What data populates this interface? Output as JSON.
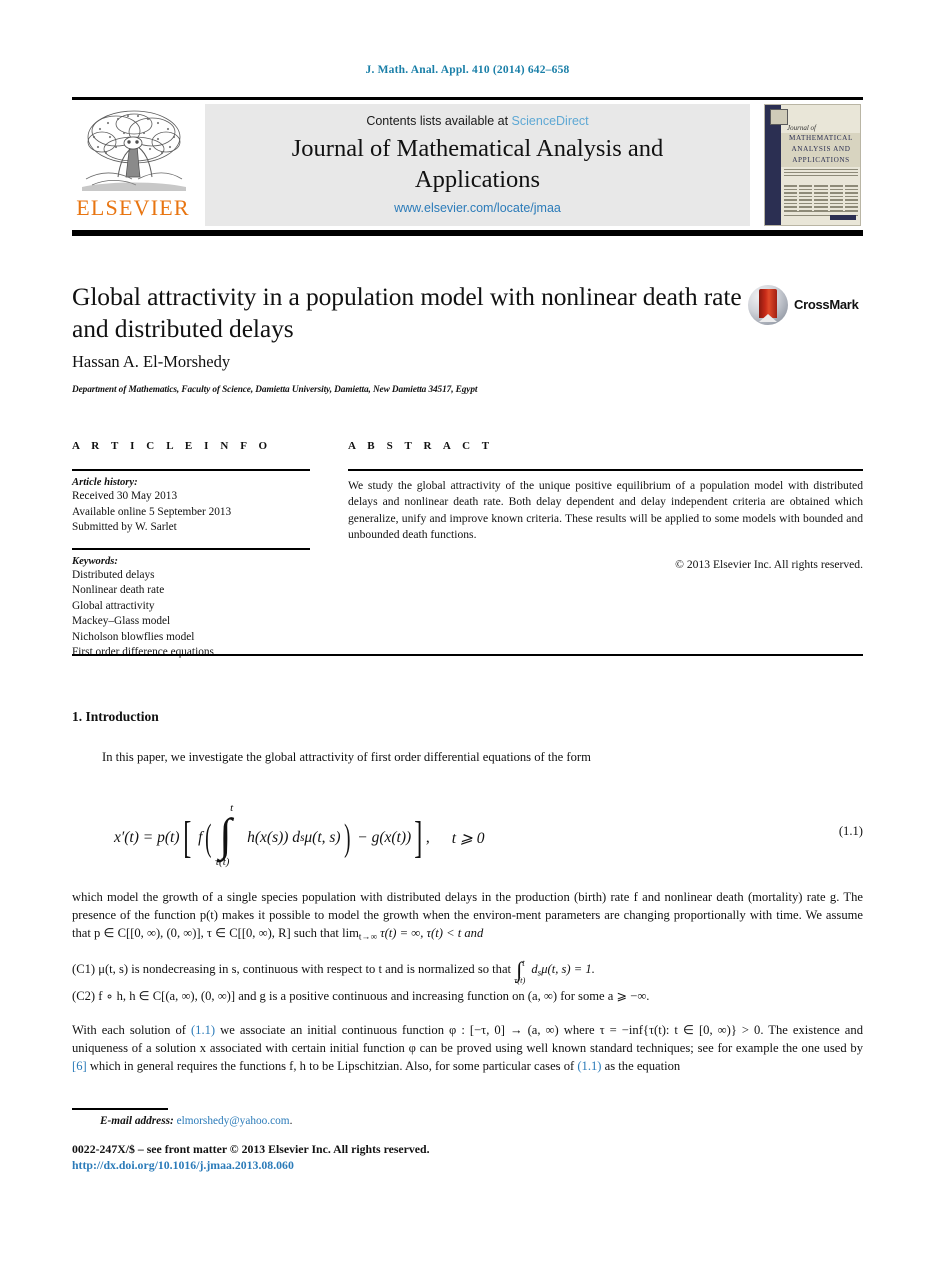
{
  "citation_header": "J. Math. Anal. Appl. 410 (2014) 642–658",
  "masthead": {
    "contents_prefix": "Contents lists available at",
    "sciencedirect": "ScienceDirect",
    "journal_title": "Journal of Mathematical Analysis and Applications",
    "journal_url": "www.elsevier.com/locate/jmaa",
    "publisher_wordmark": "ELSEVIER",
    "cover": {
      "journal_of": "Journal of",
      "line1": "MATHEMATICAL",
      "line2": "ANALYSIS AND",
      "line3": "APPLICATIONS"
    }
  },
  "article": {
    "title": "Global attractivity in a population model with nonlinear death rate and distributed delays",
    "crossmark_label": "CrossMark",
    "author": "Hassan A. El-Morshedy",
    "affiliation": "Department of Mathematics, Faculty of Science, Damietta University, Damietta, New Damietta 34517, Egypt"
  },
  "article_info": {
    "heading": "A R T I C L E   I N F O",
    "history_label": "Article history:",
    "history": [
      "Received 30 May 2013",
      "Available online 5 September 2013",
      "Submitted by W. Sarlet"
    ],
    "keywords_label": "Keywords:",
    "keywords": [
      "Distributed delays",
      "Nonlinear death rate",
      "Global attractivity",
      "Mackey–Glass model",
      "Nicholson blowflies model",
      "First order difference equations"
    ]
  },
  "abstract": {
    "heading": "A B S T R A C T",
    "text": "We study the global attractivity of the unique positive equilibrium of a population model with distributed delays and nonlinear death rate. Both delay dependent and delay independent criteria are obtained which generalize, unify and improve known criteria. These results will be applied to some models with bounded and unbounded death functions.",
    "copyright": "© 2013 Elsevier Inc. All rights reserved."
  },
  "body": {
    "section_title": "1. Introduction",
    "intro_paragraph": "In this paper, we investigate the global attractivity of first order differential equations of the form",
    "equation": {
      "number": "(1.1)",
      "lhs": "x′(t) = p(t)",
      "integral_upper": "t",
      "integral_lower": "τ(t)",
      "integrand": "h(x(s)) d",
      "integrand_sub": "s",
      "integrand_tail": "μ(t, s)",
      "minus_term": "− g(x(t))",
      "condition": "t ⩾ 0",
      "f_symbol": "f"
    },
    "paragraph_after_eq_1": "which model the growth of a single species population with distributed delays in the production (birth) rate f and nonlinear death (mortality) rate g. The presence of the function p(t) makes it possible to model the growth when the environ-ment parameters are changing proportionally with time. We assume that p ∈ C[[0, ∞), (0, ∞)], τ ∈ C[[0, ∞), R] such that",
    "paragraph_after_eq_1_tail": "lim",
    "limit_sub": "t→∞",
    "limit_rest": " τ(t) = ∞, τ(t) < t and",
    "condition_c1": "(C1)  μ(t, s) is nondecreasing in s, continuous with respect to t and is normalized so that",
    "condition_c1_int": "∫",
    "condition_c1_int_top": "t",
    "condition_c1_int_bot": "τ(t)",
    "condition_c1_tail": "d",
    "condition_c1_tail_sub": "s",
    "condition_c1_tail_rest": "μ(t, s) = 1.",
    "condition_c2": "(C2)  f ∘ h, h ∈ C[(a, ∞), (0, ∞)] and g is a positive continuous and increasing function on (a, ∞) for some a ⩾ −∞.",
    "final_paragraph_parts": {
      "p1": "With each solution of ",
      "ref1": "(1.1)",
      "p2": " we associate an initial continuous function φ : [−τ, 0] → (a, ∞) where τ = −inf{τ(t): t ∈ [0, ∞)} > 0. The existence and uniqueness of a solution x associated with certain initial function φ can be proved using well known standard techniques; see for example the one used by ",
      "ref2": "[6]",
      "p3": " which in general requires the functions f, h to be Lipschitzian. Also, for some particular cases of ",
      "ref3": "(1.1)",
      "p4": " as the equation"
    }
  },
  "footer": {
    "email_label": "E-mail address:",
    "email": "elmorshedy@yahoo.com",
    "email_period": ".",
    "imprint": "0022-247X/$ – see front matter  © 2013 Elsevier Inc. All rights reserved.",
    "doi": "http://dx.doi.org/10.1016/j.jmaa.2013.08.060"
  },
  "colors": {
    "link_blue": "#2b7bb9",
    "header_blue": "#1a7fa8",
    "sciencedirect_blue": "#5ea8d4",
    "elsevier_orange": "#E87511",
    "band_grey": "#e8e8e8"
  }
}
